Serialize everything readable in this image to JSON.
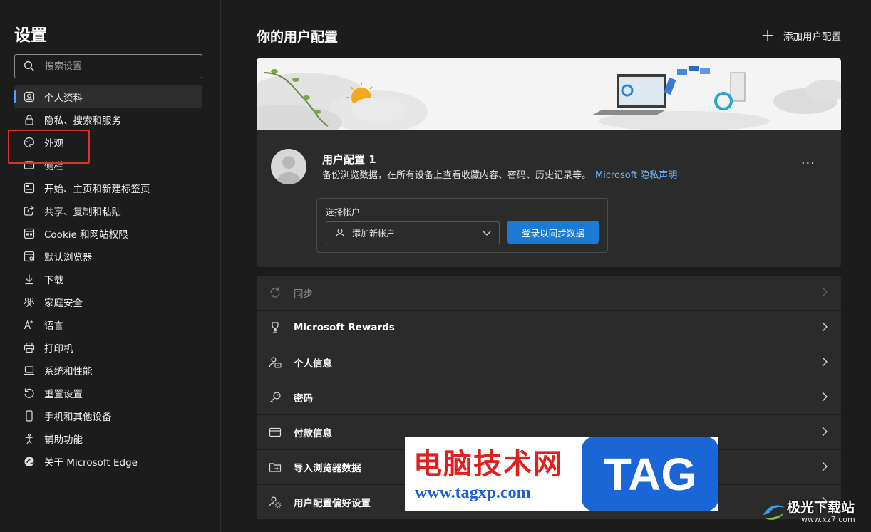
{
  "sidebar": {
    "title": "设置",
    "search_placeholder": "搜索设置",
    "items": [
      {
        "label": "个人资料",
        "icon": "profile-icon",
        "active": true
      },
      {
        "label": "隐私、搜索和服务",
        "icon": "lock-icon"
      },
      {
        "label": "外观",
        "icon": "palette-icon"
      },
      {
        "label": "侧栏",
        "icon": "sidebar-icon"
      },
      {
        "label": "开始、主页和新建标签页",
        "icon": "home-icon"
      },
      {
        "label": "共享、复制和粘贴",
        "icon": "share-icon"
      },
      {
        "label": "Cookie 和网站权限",
        "icon": "cookie-icon"
      },
      {
        "label": "默认浏览器",
        "icon": "browser-icon"
      },
      {
        "label": "下载",
        "icon": "download-icon"
      },
      {
        "label": "家庭安全",
        "icon": "family-icon"
      },
      {
        "label": "语言",
        "icon": "language-icon"
      },
      {
        "label": "打印机",
        "icon": "printer-icon"
      },
      {
        "label": "系统和性能",
        "icon": "laptop-icon"
      },
      {
        "label": "重置设置",
        "icon": "reset-icon"
      },
      {
        "label": "手机和其他设备",
        "icon": "phone-icon"
      },
      {
        "label": "辅助功能",
        "icon": "accessibility-icon"
      },
      {
        "label": "关于 Microsoft Edge",
        "icon": "edge-icon"
      }
    ]
  },
  "main": {
    "title": "你的用户配置",
    "add_profile_label": "添加用户配置",
    "profile": {
      "name": "用户配置 1",
      "description": "备份浏览数据，在所有设备上查看收藏内容、密码、历史记录等。",
      "privacy_link": "Microsoft 隐私声明",
      "more_label": "···"
    },
    "account": {
      "label": "选择帐户",
      "select_value": "添加新帐户",
      "signin_button": "登录以同步数据"
    },
    "rows": [
      {
        "label": "同步",
        "icon": "sync-icon",
        "dim": true
      },
      {
        "label": "Microsoft Rewards",
        "icon": "trophy-icon"
      },
      {
        "label": "个人信息",
        "icon": "person-card-icon"
      },
      {
        "label": "密码",
        "icon": "key-icon"
      },
      {
        "label": "付款信息",
        "icon": "card-icon"
      },
      {
        "label": "导入浏览器数据",
        "icon": "import-icon"
      },
      {
        "label": "用户配置偏好设置",
        "icon": "profile-settings-icon"
      }
    ]
  },
  "watermark": {
    "site_name": "电脑技术网",
    "url": "www.tagxp.com",
    "tag": "TAG",
    "corner_text": "极光下载站",
    "corner_url": "www.xz7.com"
  },
  "colors": {
    "accent": "#4ea1ff",
    "button": "#1a7ad4",
    "highlight": "#e0312d"
  }
}
